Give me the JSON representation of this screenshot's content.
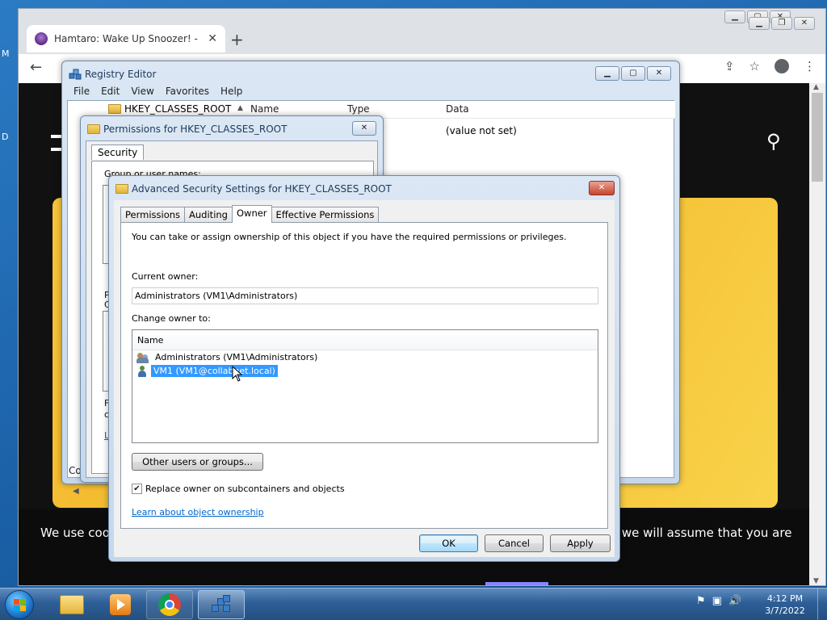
{
  "desktop": {
    "fragments": [
      "M",
      "D"
    ]
  },
  "browser": {
    "tab_title": "Hamtaro: Wake Up Snoozer! - Of",
    "tab_close": "✕",
    "new_tab": "+",
    "back": "←",
    "cookie_left": "We use coo",
    "cookie_right": "te we will assume that you are"
  },
  "regedit": {
    "title": "Registry Editor",
    "menu": [
      "File",
      "Edit",
      "View",
      "Favorites",
      "Help"
    ],
    "tree_item": "HKEY_CLASSES_ROOT",
    "columns": [
      "Name",
      "Type",
      "Data"
    ],
    "data_value": "(value not set)",
    "status": "Co"
  },
  "permissions": {
    "title": "Permissions for HKEY_CLASSES_ROOT",
    "tab": "Security",
    "group_label": "Group or user names:",
    "fragments": [
      "P",
      "C",
      "F",
      "c",
      "L"
    ]
  },
  "advanced": {
    "title": "Advanced Security Settings for HKEY_CLASSES_ROOT",
    "tabs": [
      "Permissions",
      "Auditing",
      "Owner",
      "Effective Permissions"
    ],
    "active_tab": "Owner",
    "intro": "You can take or assign ownership of this object if you have the required permissions or privileges.",
    "current_owner_label": "Current owner:",
    "current_owner_value": "Administrators (VM1\\Administrators)",
    "change_owner_label": "Change owner to:",
    "list_header": "Name",
    "owners": [
      {
        "name": "Administrators (VM1\\Administrators)",
        "icon": "group-icon",
        "selected": false
      },
      {
        "name": "VM1 (VM1@collabnet.local)",
        "icon": "user-icon",
        "selected": true
      }
    ],
    "other_users_button": "Other users or groups...",
    "replace_owner_label": "Replace owner on subcontainers and objects",
    "replace_owner_checked": true,
    "learn_link": "Learn about object ownership",
    "ok": "OK",
    "cancel": "Cancel",
    "apply": "Apply"
  },
  "taskbar": {
    "items": [
      "Windows Explorer",
      "Windows Media Player",
      "Google Chrome",
      "Registry Editor"
    ],
    "time": "4:12 PM",
    "date": "3/7/2022"
  },
  "colors": {
    "selection": "#3399ff",
    "link": "#0066cc",
    "taskbar": "#2e5e97"
  }
}
